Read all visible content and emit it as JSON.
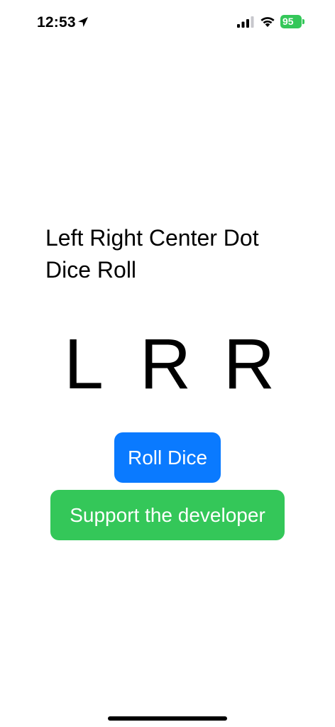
{
  "status_bar": {
    "time": "12:53",
    "battery_percent": "95",
    "battery_color": "#34c759",
    "icons": [
      "location-arrow-icon",
      "cellular-signal-icon",
      "wifi-icon",
      "battery-icon"
    ]
  },
  "main": {
    "title": "Left Right Center Dot Dice Roll",
    "dice": [
      "L",
      "R",
      "R"
    ]
  },
  "buttons": {
    "roll_label": "Roll Dice",
    "roll_color": "#0a7aff",
    "support_label": "Support the developer",
    "support_color": "#34c759"
  }
}
